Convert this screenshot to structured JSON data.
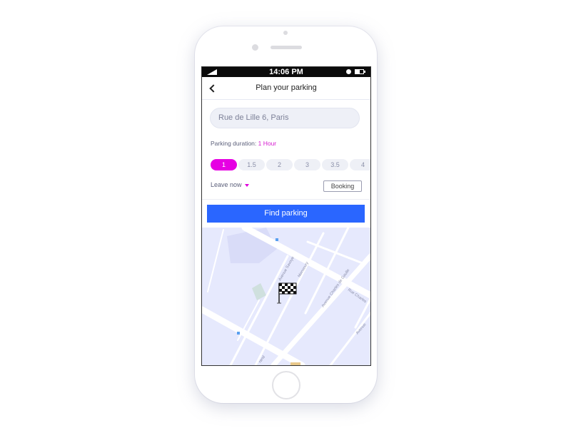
{
  "status_bar": {
    "time": "14:06 PM",
    "icons": [
      "signal-icon",
      "alarm-icon",
      "battery-icon"
    ]
  },
  "header": {
    "back_icon": "chevron-left-icon",
    "title": "Plan your parking"
  },
  "address": {
    "value": "Rue de Lille 6, Paris",
    "placeholder": "Rue de Lille 6, Paris"
  },
  "duration": {
    "label": "Parking duration: ",
    "value": "1 Hour",
    "options": [
      "1",
      "1.5",
      "2",
      "3",
      "3.5",
      "4"
    ],
    "selected": "1"
  },
  "leave": {
    "label": "Leave now",
    "icon": "caret-down-icon"
  },
  "booking": {
    "label": "Booking"
  },
  "find": {
    "label": "Find parking"
  },
  "map": {
    "street_labels": [
      "Avenue Savoye",
      "Mansoury",
      "Avenue Charles de Gaulle",
      "Rue Charles",
      "Avenue",
      "rand"
    ],
    "marker_icon": "checkered-flag-icon"
  },
  "colors": {
    "accent": "#e600e3",
    "primary_button": "#2a66ff",
    "map_background": "#e6e9fd"
  }
}
